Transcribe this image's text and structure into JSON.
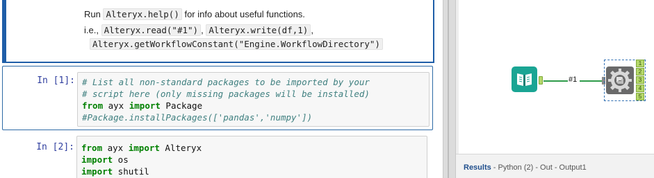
{
  "markdown": {
    "line1_prefix": "Run",
    "line1_code": "Alteryx.help()",
    "line1_suffix": "for info about useful functions.",
    "line2_prefix": "i.e.,",
    "line2_code1": "Alteryx.read(\"#1\")",
    "line2_sep": ",",
    "line2_code2": "Alteryx.write(df,1)",
    "line2_suffix": ",",
    "line3_code": "Alteryx.getWorkflowConstant(\"Engine.WorkflowDirectory\")"
  },
  "cells": [
    {
      "prompt": "In [1]:",
      "lines": [
        "# List all non-standard packages to be imported by your",
        "# script here (only missing packages will be installed)",
        {
          "kw": "from",
          "mid": " ayx ",
          "kw2": "import",
          "rest": " Package"
        },
        "#Package.installPackages(['pandas','numpy'])"
      ]
    },
    {
      "prompt": "In [2]:",
      "lines": [
        {
          "kw": "from",
          "mid": " ayx ",
          "kw2": "import",
          "rest": " Alteryx"
        },
        {
          "kw": "import",
          "rest": " os"
        },
        {
          "kw": "import",
          "rest": " shutil"
        }
      ]
    }
  ],
  "workflow": {
    "connection_label": "#1",
    "output_anchors": [
      "1",
      "2",
      "3",
      "4",
      "5"
    ],
    "colors": {
      "input_tool": "#1aa594",
      "python_tool": "#6a6a6a",
      "connection": "#2e9b4a",
      "anchor": "#b5d86a"
    },
    "icons": [
      "book-icon",
      "python-gear-icon"
    ]
  },
  "results": {
    "title": "Results",
    "detail": " - Python (2) - Out - Output1"
  }
}
